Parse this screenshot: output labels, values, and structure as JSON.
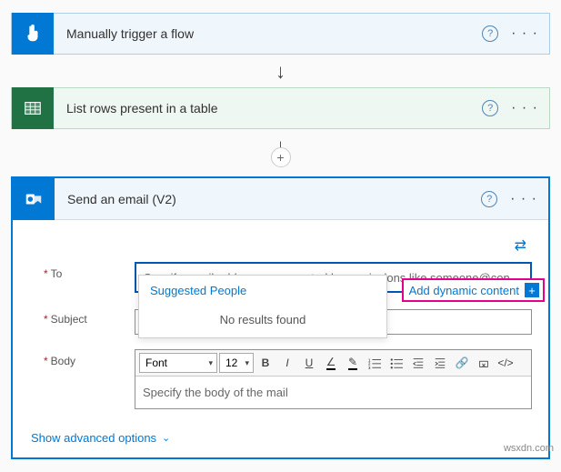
{
  "steps": {
    "trigger": {
      "title": "Manually trigger a flow"
    },
    "listrows": {
      "title": "List rows present in a table"
    },
    "email": {
      "title": "Send an email (V2)"
    }
  },
  "email_form": {
    "to_label": "To",
    "to_placeholder": "Specify email addresses separated by semicolons like someone@con",
    "subject_label": "Subject",
    "body_label": "Body",
    "body_placeholder": "Specify the body of the mail",
    "toolbar": {
      "font_label": "Font",
      "size_label": "12"
    }
  },
  "suggest": {
    "header": "Suggested People",
    "noresults": "No results found"
  },
  "dynamic": {
    "label": "Add dynamic content"
  },
  "advanced": "Show advanced options",
  "watermark": "wsxdn.com"
}
